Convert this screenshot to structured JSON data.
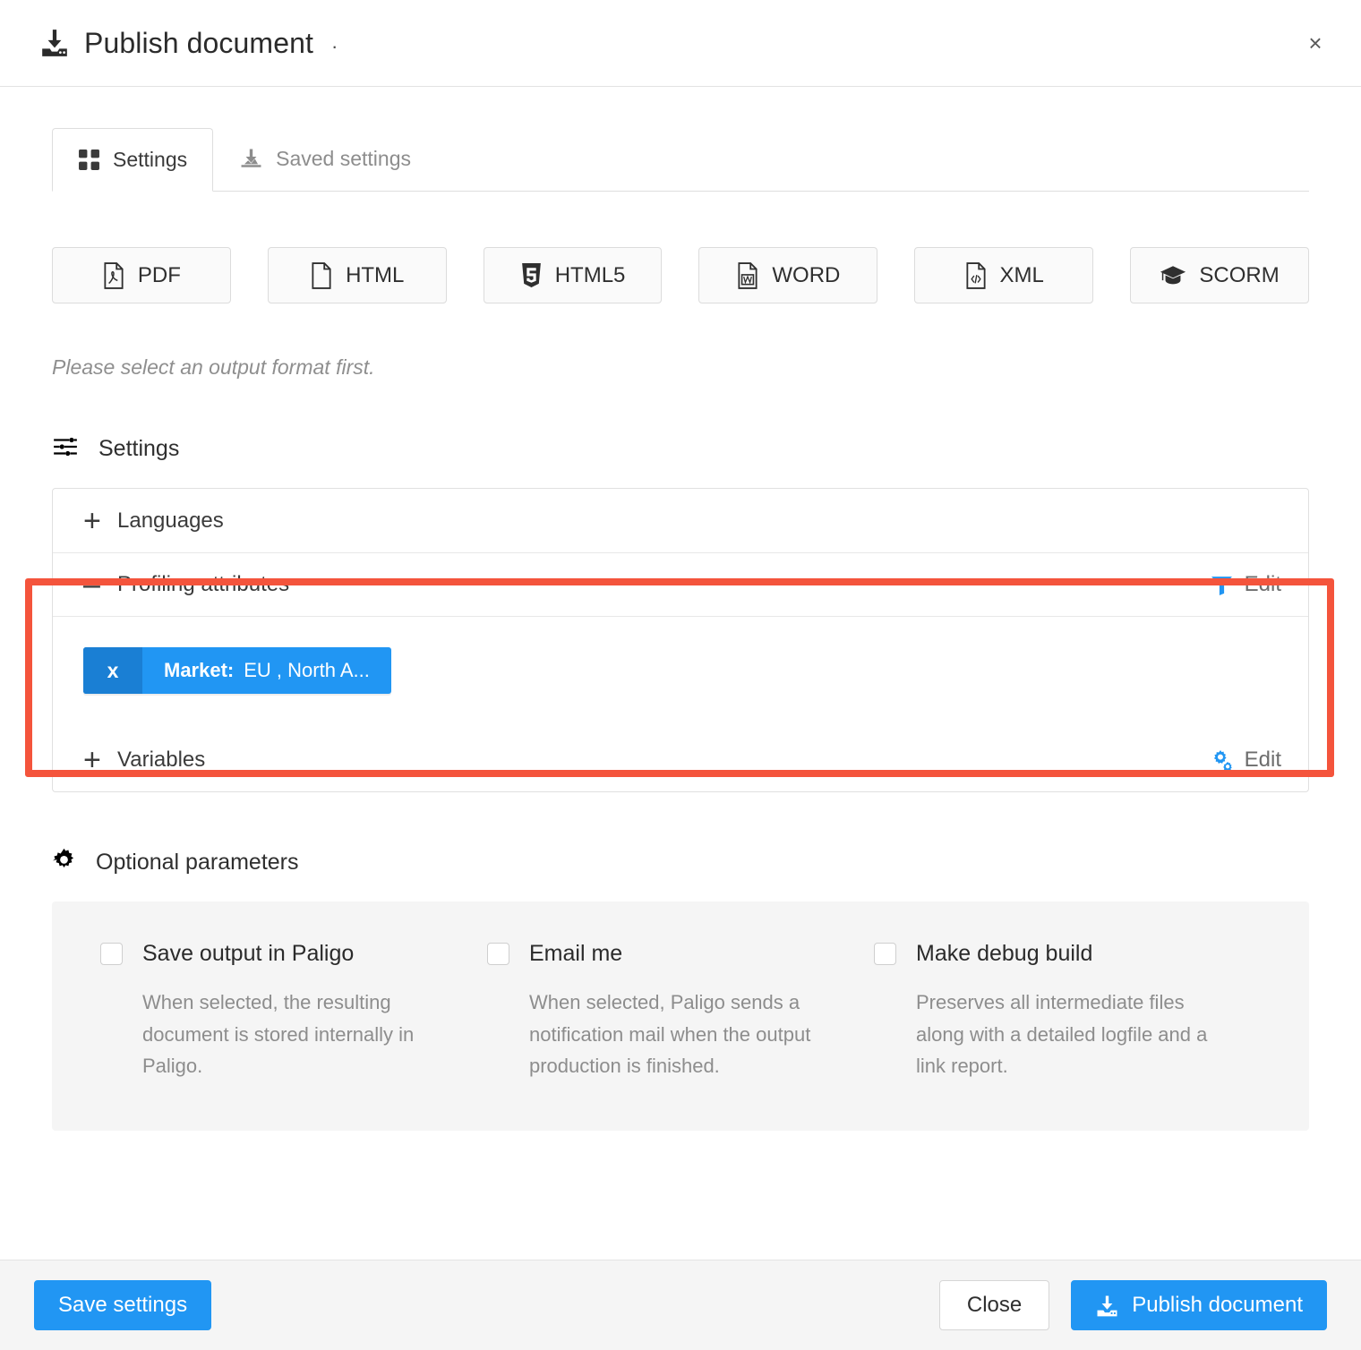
{
  "header": {
    "title": "Publish document",
    "title_suffix": "·",
    "icon": "publish-download-icon",
    "close_label": "×"
  },
  "tabs": [
    {
      "label": "Settings",
      "icon": "grid-squares-icon",
      "active": true
    },
    {
      "label": "Saved settings",
      "icon": "saved-download-icon",
      "active": false
    }
  ],
  "formats": [
    {
      "label": "PDF",
      "icon": "pdf-file-icon"
    },
    {
      "label": "HTML",
      "icon": "html-file-icon"
    },
    {
      "label": "HTML5",
      "icon": "html5-shield-icon"
    },
    {
      "label": "WORD",
      "icon": "word-file-icon"
    },
    {
      "label": "XML",
      "icon": "xml-file-icon"
    },
    {
      "label": "SCORM",
      "icon": "graduation-cap-icon"
    }
  ],
  "hint": "Please select an output format first.",
  "settings_section": {
    "title": "Settings",
    "icon": "sliders-icon",
    "rows": [
      {
        "sign": "+",
        "label": "Languages",
        "edit": null,
        "edit_icon": null,
        "expanded": false
      },
      {
        "sign": "–",
        "label": "Profiling attributes",
        "edit": "Edit",
        "edit_icon": "filter-funnel-icon",
        "expanded": true
      },
      {
        "sign": "+",
        "label": "Variables",
        "edit": "Edit",
        "edit_icon": "cogs-icon",
        "expanded": false
      }
    ],
    "profiling_tags": [
      {
        "close": "x",
        "key": "Market:",
        "value": "EU , North A..."
      }
    ]
  },
  "optional_parameters": {
    "title": "Optional parameters",
    "icon": "gear-icon",
    "items": [
      {
        "label": "Save output in Paligo",
        "checked": false,
        "description": "When selected, the resulting document is stored internally in Paligo."
      },
      {
        "label": "Email me",
        "checked": false,
        "description": "When selected, Paligo sends a notification mail when the output production is finished."
      },
      {
        "label": "Make debug build",
        "checked": false,
        "description": "Preserves all intermediate files along with a detailed logfile and a link report."
      }
    ]
  },
  "footer": {
    "save_settings_label": "Save settings",
    "close_label": "Close",
    "publish_label": "Publish document",
    "publish_icon": "publish-download-icon"
  },
  "colors": {
    "accent_blue": "#2196f3",
    "tag_close_blue": "#1a7fd4",
    "highlight_red": "#f4543c",
    "panel_gray": "#f5f5f5",
    "muted_text": "#8d8d8d"
  }
}
